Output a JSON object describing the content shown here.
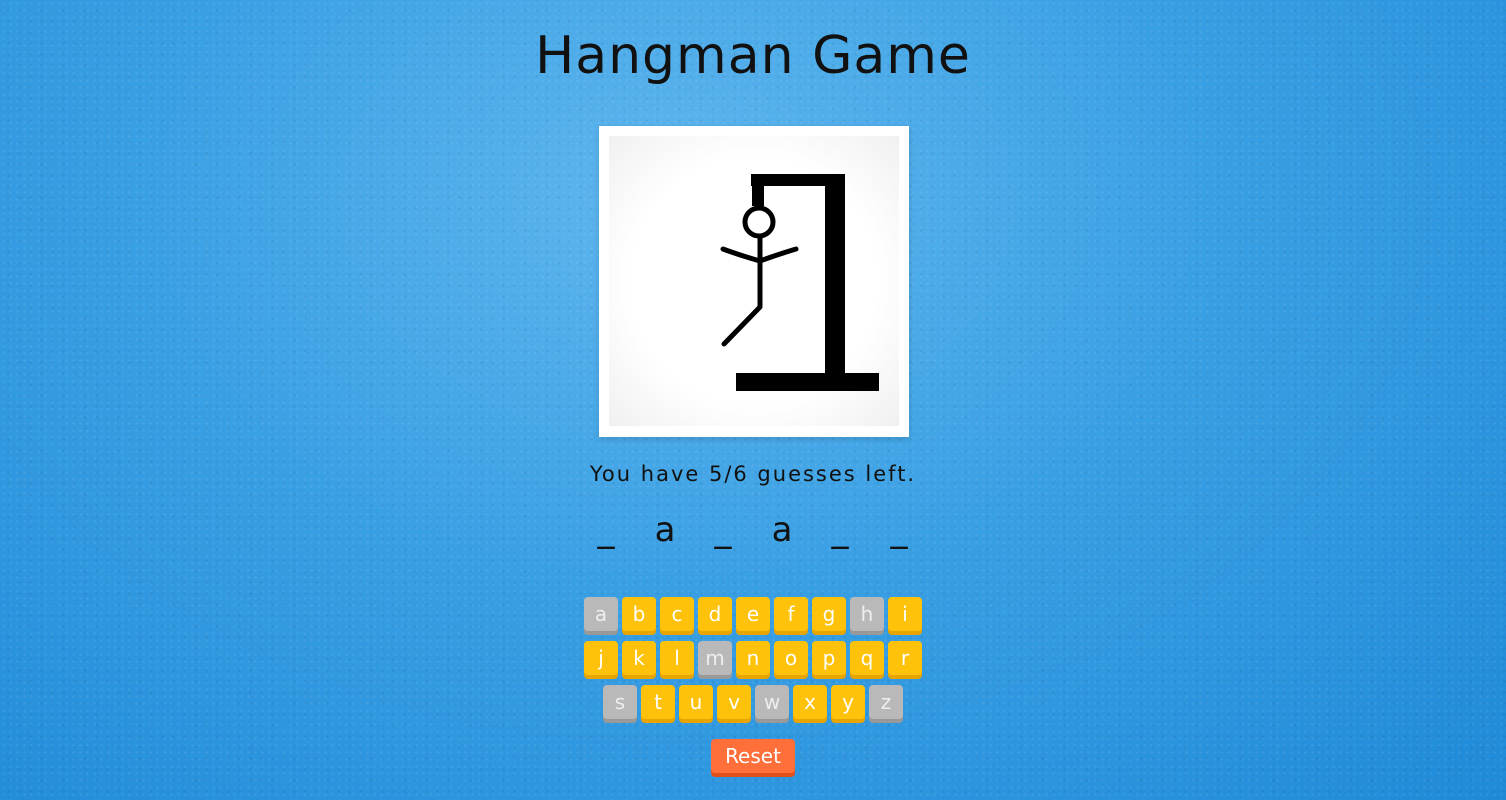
{
  "title": "Hangman Game",
  "status": {
    "text": "You have 5/6 guesses left."
  },
  "word": {
    "slots": [
      "_",
      "a",
      "_",
      "a",
      "_",
      "_"
    ]
  },
  "keyboard": {
    "rows": [
      [
        {
          "letter": "a",
          "used": true
        },
        {
          "letter": "b",
          "used": false
        },
        {
          "letter": "c",
          "used": false
        },
        {
          "letter": "d",
          "used": false
        },
        {
          "letter": "e",
          "used": false
        },
        {
          "letter": "f",
          "used": false
        },
        {
          "letter": "g",
          "used": false
        },
        {
          "letter": "h",
          "used": true
        },
        {
          "letter": "i",
          "used": false
        }
      ],
      [
        {
          "letter": "j",
          "used": false
        },
        {
          "letter": "k",
          "used": false
        },
        {
          "letter": "l",
          "used": false
        },
        {
          "letter": "m",
          "used": true
        },
        {
          "letter": "n",
          "used": false
        },
        {
          "letter": "o",
          "used": false
        },
        {
          "letter": "p",
          "used": false
        },
        {
          "letter": "q",
          "used": false
        },
        {
          "letter": "r",
          "used": false
        }
      ],
      [
        {
          "letter": "s",
          "used": true
        },
        {
          "letter": "t",
          "used": false
        },
        {
          "letter": "u",
          "used": false
        },
        {
          "letter": "v",
          "used": false
        },
        {
          "letter": "w",
          "used": true
        },
        {
          "letter": "x",
          "used": false
        },
        {
          "letter": "y",
          "used": false
        },
        {
          "letter": "z",
          "used": true
        }
      ]
    ]
  },
  "reset": {
    "label": "Reset"
  },
  "colors": {
    "key": "#ffc20a",
    "key_used": "#b9b9b9",
    "reset": "#ff6f3a",
    "background": "#3aa0e4"
  },
  "figure": {
    "parts_shown": [
      "head",
      "body",
      "left-arm",
      "right-arm",
      "left-leg"
    ]
  }
}
